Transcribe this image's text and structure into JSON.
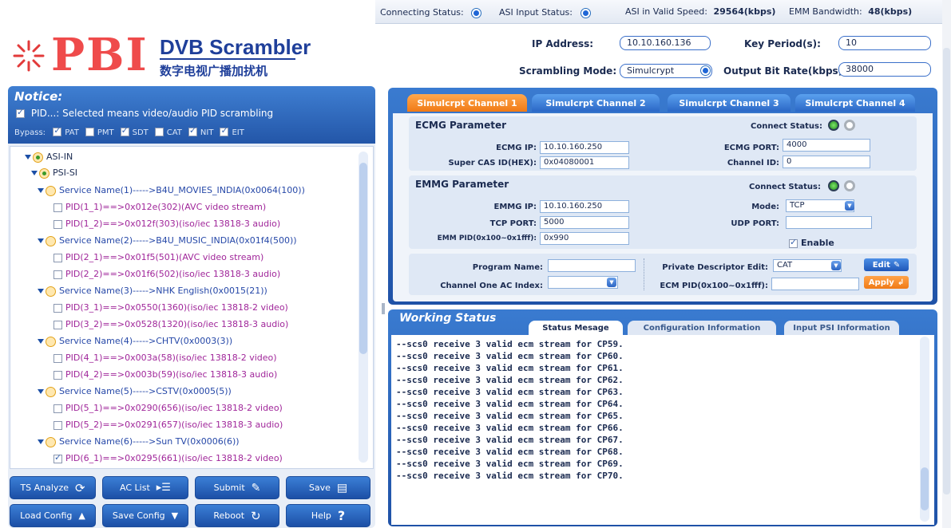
{
  "status_bar": {
    "connecting_label": "Connecting Status:",
    "asi_input_label": "ASI Input Status:",
    "asi_speed_label": "ASI in Valid Speed:",
    "asi_speed_value": "29564(kbps)",
    "emm_bw_label": "EMM Bandwidth:",
    "emm_bw_value": "48(kbps)"
  },
  "logo": {
    "pbi": "PBI",
    "title": "DVB Scrambler",
    "subtitle": "数字电视广播加扰机"
  },
  "header": {
    "ip_label": "IP Address:",
    "ip_value": "10.10.160.136",
    "key_period_label": "Key Period(s):",
    "key_period_value": "10",
    "mode_label": "Scrambling Mode:",
    "mode_value": "Simulcrypt",
    "bitrate_label": "Output Bit Rate(kbps):",
    "bitrate_value": "38000"
  },
  "notice": {
    "title": "Notice:",
    "text": "PID...: Selected means video/audio PID scrambling",
    "bypass_label": "Bypass:",
    "bypass": [
      {
        "label": "PAT",
        "checked": true
      },
      {
        "label": "PMT",
        "checked": false
      },
      {
        "label": "SDT",
        "checked": true
      },
      {
        "label": "CAT",
        "checked": false
      },
      {
        "label": "NIT",
        "checked": true
      },
      {
        "label": "EIT",
        "checked": true
      }
    ]
  },
  "tree": {
    "root": "ASI-IN",
    "psi": "PSI-SI",
    "services": [
      {
        "name": "Service Name(1)----->B4U_MOVIES_INDIA(0x0064(100))",
        "pids": [
          {
            "label": "PID(1_1)==>0x012e(302)(AVC video stream)",
            "checked": false
          },
          {
            "label": "PID(1_2)==>0x012f(303)(iso/iec 13818-3 audio)",
            "checked": false
          }
        ]
      },
      {
        "name": "Service Name(2)----->B4U_MUSIC_INDIA(0x01f4(500))",
        "pids": [
          {
            "label": "PID(2_1)==>0x01f5(501)(AVC video stream)",
            "checked": false
          },
          {
            "label": "PID(2_2)==>0x01f6(502)(iso/iec 13818-3 audio)",
            "checked": false
          }
        ]
      },
      {
        "name": "Service Name(3)----->NHK English(0x0015(21))",
        "pids": [
          {
            "label": "PID(3_1)==>0x0550(1360)(iso/iec 13818-2 video)",
            "checked": false
          },
          {
            "label": "PID(3_2)==>0x0528(1320)(iso/iec 13818-3 audio)",
            "checked": false
          }
        ]
      },
      {
        "name": "Service Name(4)----->CHTV(0x0003(3))",
        "pids": [
          {
            "label": "PID(4_1)==>0x003a(58)(iso/iec 13818-2 video)",
            "checked": false
          },
          {
            "label": "PID(4_2)==>0x003b(59)(iso/iec 13818-3 audio)",
            "checked": false
          }
        ]
      },
      {
        "name": "Service Name(5)----->CSTV(0x0005(5))",
        "pids": [
          {
            "label": "PID(5_1)==>0x0290(656)(iso/iec 13818-2 video)",
            "checked": false
          },
          {
            "label": "PID(5_2)==>0x0291(657)(iso/iec 13818-3 audio)",
            "checked": false
          }
        ]
      },
      {
        "name": "Service Name(6)----->Sun TV(0x0006(6))",
        "pids": [
          {
            "label": "PID(6_1)==>0x0295(661)(iso/iec 13818-2 video)",
            "checked": true
          }
        ]
      }
    ]
  },
  "buttons": {
    "ts_analyze": "TS Analyze",
    "ac_list": "AC List",
    "submit": "Submit",
    "save": "Save",
    "load_config": "Load Config",
    "save_config": "Save Config",
    "reboot": "Reboot",
    "help": "Help"
  },
  "channel_tabs": [
    "Simulcrpt Channel 1",
    "Simulcrpt Channel 2",
    "Simulcrpt Channel 3",
    "Simulcrpt Channel 4"
  ],
  "ecmg": {
    "title": "ECMG Parameter",
    "connect_label": "Connect Status:",
    "ip_label": "ECMG IP:",
    "ip_value": "10.10.160.250",
    "port_label": "ECMG PORT:",
    "port_value": "4000",
    "cas_label": "Super CAS ID(HEX):",
    "cas_value": "0x04080001",
    "channel_label": "Channel ID:",
    "channel_value": "0"
  },
  "emmg": {
    "title": "EMMG Parameter",
    "connect_label": "Connect Status:",
    "ip_label": "EMMG IP:",
    "ip_value": "10.10.160.250",
    "mode_label": "Mode:",
    "mode_value": "TCP",
    "tcp_label": "TCP PORT:",
    "tcp_value": "5000",
    "udp_label": "UDP PORT:",
    "udp_value": "",
    "pid_label": "EMM PID(0x100~0x1fff):",
    "pid_value": "0x990",
    "enable_label": "Enable"
  },
  "program": {
    "name_label": "Program Name:",
    "name_value": "",
    "ac_label": "Channel One AC Index:",
    "ac_value": "",
    "pde_label": "Private Descriptor Edit:",
    "pde_value": "CAT",
    "ecm_pid_label": "ECM PID(0x100~0x1fff):",
    "ecm_pid_value": "",
    "edit_button": "Edit",
    "apply_button": "Apply"
  },
  "working": {
    "title": "Working Status",
    "tabs": [
      "Status Mesage",
      "Configuration Information",
      "Input PSI Information"
    ],
    "log": [
      "--scs0 receive 3 valid ecm stream for CP59.",
      "--scs0 receive 3 valid ecm stream for CP60.",
      "--scs0 receive 3 valid ecm stream for CP61.",
      "--scs0 receive 3 valid ecm stream for CP62.",
      "--scs0 receive 3 valid ecm stream for CP63.",
      "--scs0 receive 3 valid ecm stream for CP64.",
      "--scs0 receive 3 valid ecm stream for CP65.",
      "--scs0 receive 3 valid ecm stream for CP66.",
      "--scs0 receive 3 valid ecm stream for CP67.",
      "--scs0 receive 3 valid ecm stream for CP68.",
      "--scs0 receive 3 valid ecm stream for CP69.",
      "--scs0 receive 3 valid ecm stream for CP70."
    ]
  }
}
